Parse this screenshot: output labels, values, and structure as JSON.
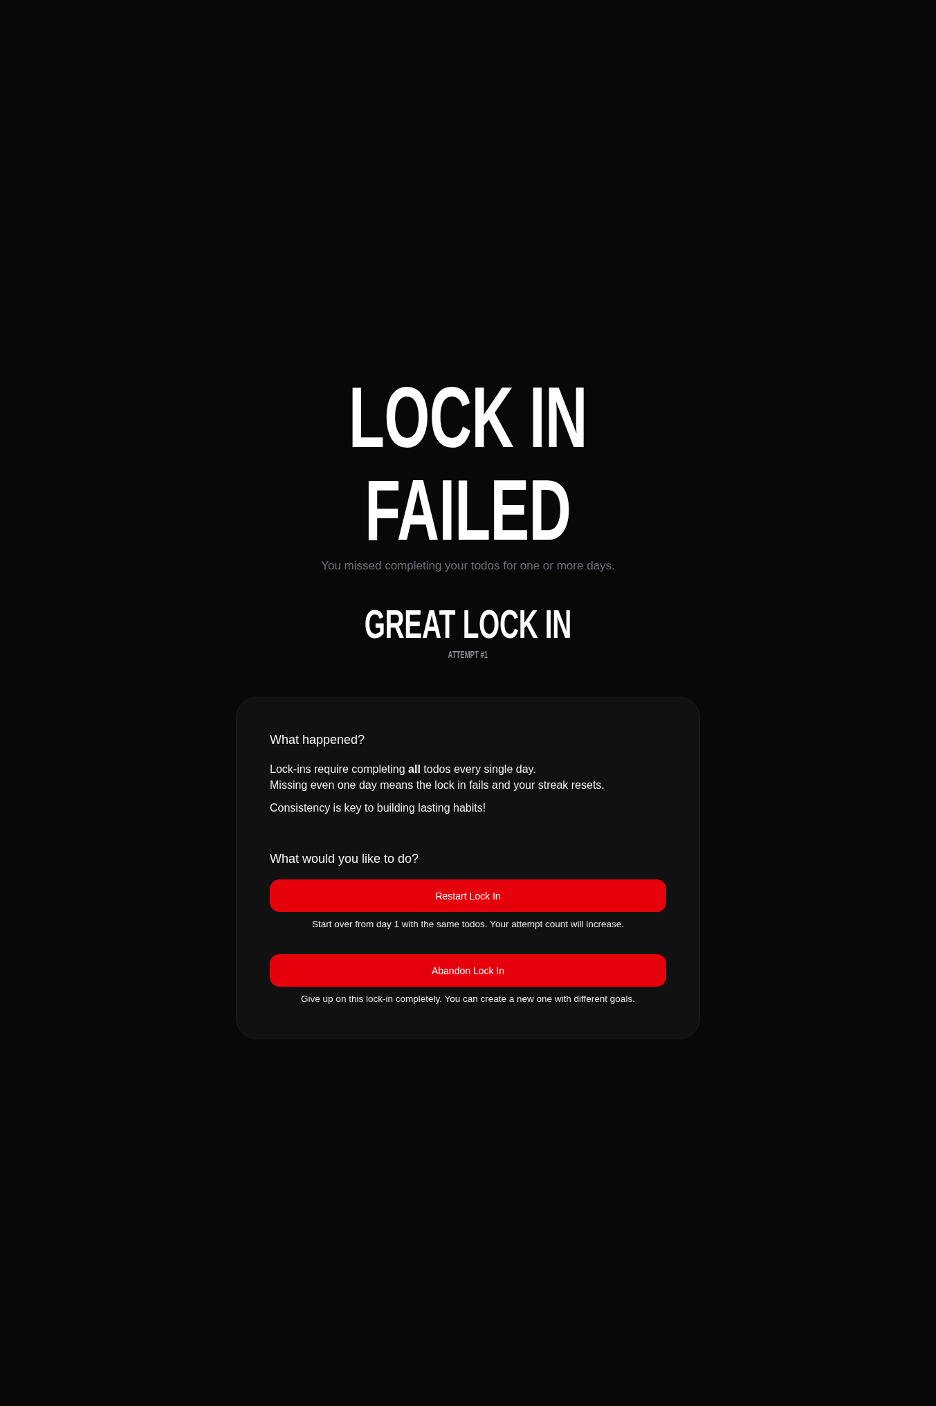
{
  "headline": {
    "lines": [
      "LOCK IN",
      "FAILED"
    ]
  },
  "subtitle": "You missed completing your todos for one or more days.",
  "lock_in": {
    "name": "GREAT LOCK IN",
    "attempt": "ATTEMPT #1"
  },
  "explanation": {
    "heading": "What happened?",
    "paragraphs": [
      "Lock-ins require completing **all** todos every single day.\nMissing even one day means the lock in fails and your streak resets.",
      "Consistency is key to building lasting habits!"
    ]
  },
  "actions": {
    "heading": "What would you like to do?",
    "options": [
      {
        "label": "Restart Lock In",
        "description": "Start over from day 1 with the same todos. Your attempt count will increase."
      },
      {
        "label": "Abandon Lock In",
        "description": "Give up on this lock-in completely. You can create a new one with different goals."
      }
    ]
  }
}
